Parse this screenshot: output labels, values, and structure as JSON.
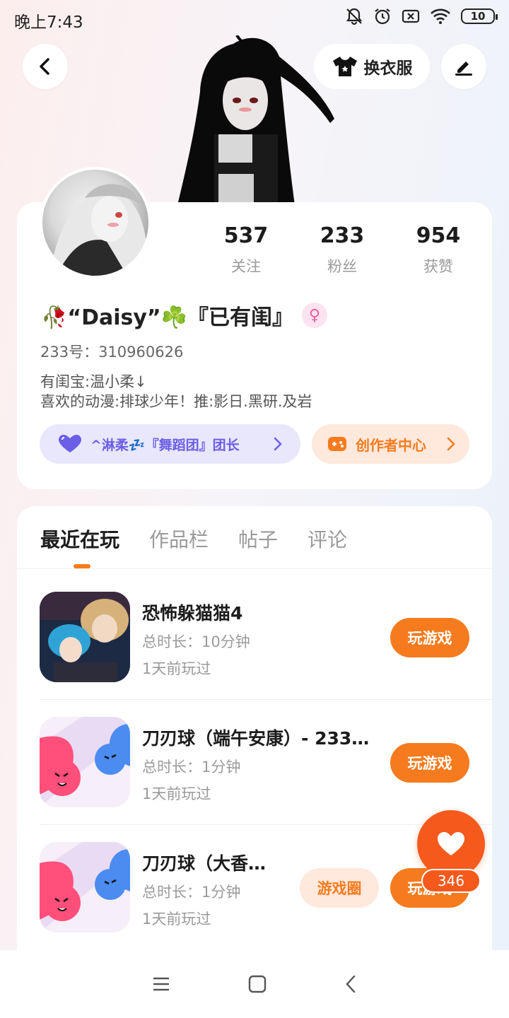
{
  "status_bar": {
    "time": "晚上7:43",
    "battery": "10"
  },
  "header": {
    "outfit_label": "换衣服"
  },
  "profile": {
    "stats": [
      {
        "value": "537",
        "label": "关注"
      },
      {
        "value": "233",
        "label": "粉丝"
      },
      {
        "value": "954",
        "label": "获赞"
      }
    ],
    "username": "🥀“Daisy”☘️『已有闺』",
    "gender_symbol": "♀",
    "uid": "233号：310960626",
    "bio_line1": "有闺宝:温小柔↓",
    "bio_line2": "喜欢的动漫:排球少年！推:影日.黑研.及岩",
    "club_label": "^淋柔💤『舞蹈团』团长",
    "creator_label": "创作者中心"
  },
  "tabs": [
    "最近在玩",
    "作品栏",
    "帖子",
    "评论"
  ],
  "games": [
    {
      "title": "恐怖躲猫猫4",
      "duration": "总时长：10分钟",
      "last_played": "1天前玩过",
      "action": "玩游戏"
    },
    {
      "title": "刀刃球（端午安康）- 233…",
      "duration": "总时长：1分钟",
      "last_played": "1天前玩过",
      "action": "玩游戏"
    },
    {
      "title": "刀刃球（大香…",
      "duration": "总时长：1分钟",
      "last_played": "1天前玩过",
      "action": "玩游戏",
      "circle_action": "游戏圈"
    }
  ],
  "like": {
    "count": "346"
  },
  "colors": {
    "accent": "#f57b1e",
    "like": "#f55a1c",
    "club": "#6a5fe6"
  }
}
